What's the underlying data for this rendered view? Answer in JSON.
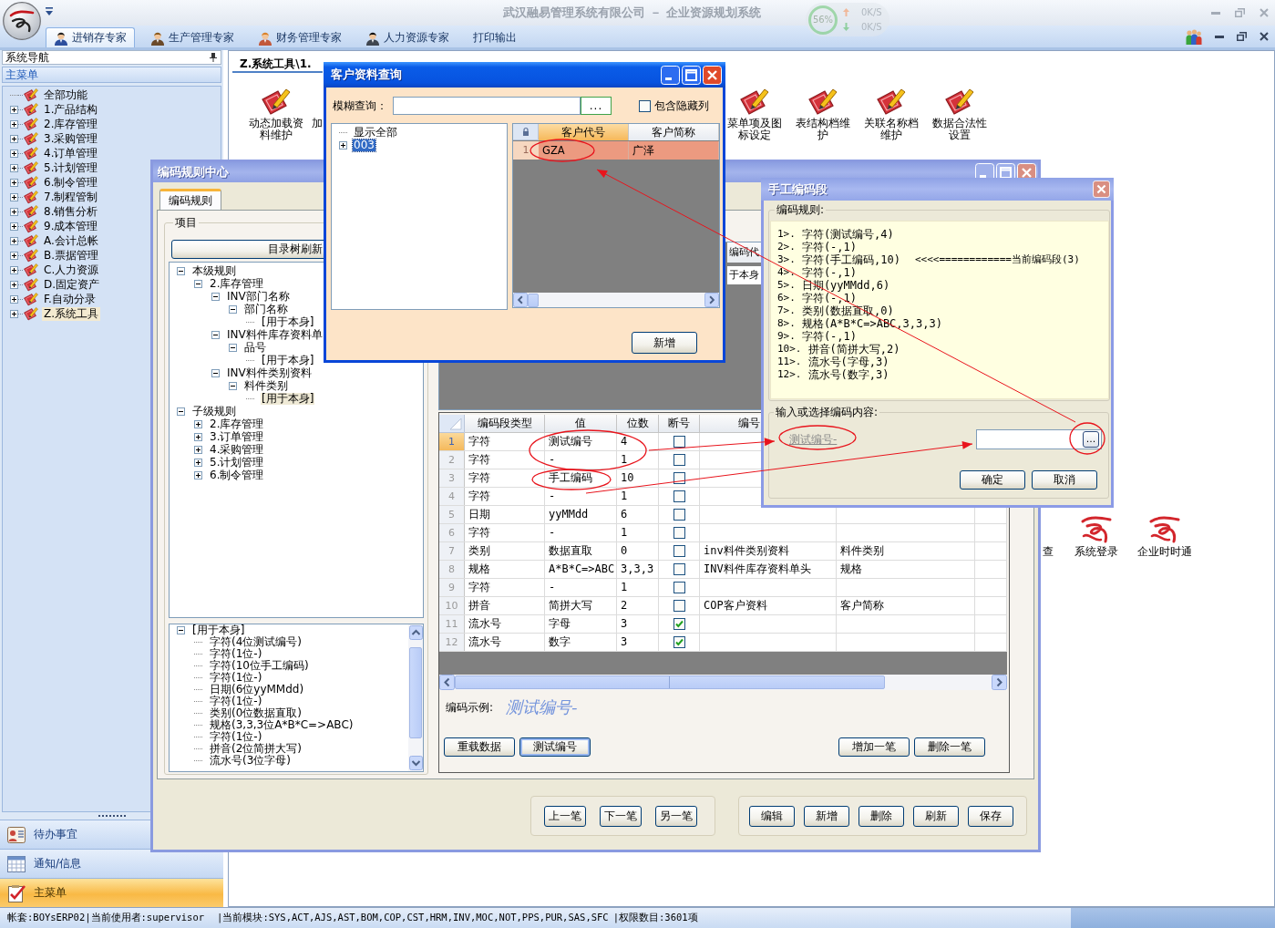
{
  "app": {
    "title": "武汉融易管理系统有限公司 － 企业资源规划系统"
  },
  "net_monitor": {
    "usage": "56%",
    "upload": "0K/S",
    "download": "0K/S"
  },
  "ribbon_tabs": [
    {
      "label": "进销存专家",
      "kind": "person",
      "selected": true
    },
    {
      "label": "生产管理专家",
      "kind": "person",
      "selected": false
    },
    {
      "label": "财务管理专家",
      "kind": "person",
      "selected": false
    },
    {
      "label": "人力资源专家",
      "kind": "person",
      "selected": false
    },
    {
      "label": "打印输出",
      "kind": "text",
      "selected": false
    }
  ],
  "sidebar": {
    "header": "系统导航",
    "menu_title": "主菜单",
    "tree": [
      {
        "label": "全部功能",
        "kind": "leaf",
        "selected": false
      },
      {
        "label": "1.产品结构",
        "kind": "folder",
        "expanded": false,
        "selected": false
      },
      {
        "label": "2.库存管理",
        "kind": "folder",
        "expanded": false,
        "selected": false
      },
      {
        "label": "3.采购管理",
        "kind": "folder",
        "expanded": false,
        "selected": false
      },
      {
        "label": "4.订单管理",
        "kind": "folder",
        "expanded": false,
        "selected": false
      },
      {
        "label": "5.计划管理",
        "kind": "folder",
        "expanded": false,
        "selected": false
      },
      {
        "label": "6.制令管理",
        "kind": "folder",
        "expanded": false,
        "selected": false
      },
      {
        "label": "7.制程管制",
        "kind": "folder",
        "expanded": false,
        "selected": false
      },
      {
        "label": "8.销售分析",
        "kind": "folder",
        "expanded": false,
        "selected": false
      },
      {
        "label": "9.成本管理",
        "kind": "folder",
        "expanded": false,
        "selected": false
      },
      {
        "label": "A.会计总帐",
        "kind": "folder",
        "expanded": false,
        "selected": false
      },
      {
        "label": "B.票据管理",
        "kind": "folder",
        "expanded": false,
        "selected": false
      },
      {
        "label": "C.人力资源",
        "kind": "folder",
        "expanded": false,
        "selected": false
      },
      {
        "label": "D.固定资产",
        "kind": "folder",
        "expanded": false,
        "selected": false
      },
      {
        "label": "F.自动分录",
        "kind": "folder",
        "expanded": false,
        "selected": false
      },
      {
        "label": "Z.系统工具",
        "kind": "folder",
        "expanded": false,
        "selected": true
      }
    ],
    "nav_buttons": [
      {
        "label": "待办事宜",
        "kind": "contacts",
        "selected": false
      },
      {
        "label": "通知/信息",
        "kind": "calendar",
        "selected": false
      },
      {
        "label": "主菜单",
        "kind": "checklist",
        "selected": true
      }
    ]
  },
  "document": {
    "tab": {
      "title": "Z.系统工具\\1.",
      "selected": true
    },
    "tool_groups": [
      [
        {
          "label": "动态加载资料维护",
          "kind": "tool"
        },
        {
          "label": "加",
          "kind": "fragment"
        }
      ],
      [
        {
          "label": "菜单项及图标设定",
          "kind": "tool"
        },
        {
          "label": "表结构档维护",
          "kind": "tool"
        },
        {
          "label": "关联名称档维护",
          "kind": "tool"
        },
        {
          "label": "数据合法性设置",
          "kind": "tool"
        }
      ],
      [
        {
          "label": "查",
          "kind": "fragment"
        },
        {
          "label": "系统登录",
          "kind": "logo"
        },
        {
          "label": "企业时时通",
          "kind": "logo"
        }
      ]
    ]
  },
  "coding_center": {
    "title": "编码规则中心",
    "tabs": [
      {
        "label": "编码规则",
        "selected": true
      }
    ],
    "group_title": "项目",
    "refresh_button": "目录树刷新",
    "rule_tree": [
      {
        "label": "本级规则",
        "kind": "folder",
        "expanded": true,
        "selected": false,
        "children": [
          {
            "label": "2.库存管理",
            "kind": "folder",
            "expanded": true,
            "selected": false,
            "children": [
              {
                "label": "INV部门名称",
                "kind": "folder",
                "expanded": true,
                "selected": false,
                "children": [
                  {
                    "label": "部门名称",
                    "kind": "folder",
                    "expanded": true,
                    "selected": false,
                    "children": [
                      {
                        "label": "[用于本身]",
                        "kind": "leaf",
                        "selected": false
                      }
                    ]
                  }
                ]
              },
              {
                "label": "INV料件库存资料单",
                "kind": "folder",
                "expanded": true,
                "selected": false,
                "children": [
                  {
                    "label": "品号",
                    "kind": "folder",
                    "expanded": true,
                    "selected": false,
                    "children": [
                      {
                        "label": "[用于本身]",
                        "kind": "leaf",
                        "selected": false
                      }
                    ]
                  }
                ]
              },
              {
                "label": "INV料件类别资料",
                "kind": "folder",
                "expanded": true,
                "selected": false,
                "children": [
                  {
                    "label": "料件类别",
                    "kind": "folder",
                    "expanded": true,
                    "selected": false,
                    "children": [
                      {
                        "label": "[用于本身]",
                        "kind": "leaf",
                        "selected": true
                      }
                    ]
                  }
                ]
              }
            ]
          }
        ]
      },
      {
        "label": "子级规则",
        "kind": "folder",
        "expanded": true,
        "selected": false,
        "children": [
          {
            "label": "2.库存管理",
            "kind": "folder",
            "expanded": false,
            "selected": false
          },
          {
            "label": "3.订单管理",
            "kind": "folder",
            "expanded": false,
            "selected": false
          },
          {
            "label": "4.采购管理",
            "kind": "folder",
            "expanded": false,
            "selected": false
          },
          {
            "label": "5.计划管理",
            "kind": "folder",
            "expanded": false,
            "selected": false
          },
          {
            "label": "6.制令管理",
            "kind": "folder",
            "expanded": false,
            "selected": false
          }
        ]
      }
    ],
    "segment_tree": [
      {
        "label": "[用于本身]",
        "kind": "folder",
        "expanded": true,
        "selected": false,
        "children": [
          {
            "label": "字符(4位测试编号)",
            "kind": "leaf",
            "selected": false
          },
          {
            "label": "字符(1位-)",
            "kind": "leaf",
            "selected": false
          },
          {
            "label": "字符(10位手工编码)",
            "kind": "leaf",
            "selected": false
          },
          {
            "label": "字符(1位-)",
            "kind": "leaf",
            "selected": false
          },
          {
            "label": "日期(6位yyMMdd)",
            "kind": "leaf",
            "selected": false
          },
          {
            "label": "字符(1位-)",
            "kind": "leaf",
            "selected": false
          },
          {
            "label": "类别(0位数据直取)",
            "kind": "leaf",
            "selected": false
          },
          {
            "label": "规格(3,3,3位A*B*C=>ABC)",
            "kind": "leaf",
            "selected": false
          },
          {
            "label": "字符(1位-)",
            "kind": "leaf",
            "selected": false
          },
          {
            "label": "拼音(2位简拼大写)",
            "kind": "leaf",
            "selected": false
          },
          {
            "label": "流水号(3位字母)",
            "kind": "leaf",
            "selected": false
          }
        ]
      }
    ],
    "upper_grid": {
      "column": "编码代",
      "cell": "于本身"
    },
    "grid": {
      "columns": [
        "编码段类型",
        "值",
        "位数",
        "断号",
        "编号"
      ],
      "rows": [
        {
          "no": "1",
          "segment_type": "字符",
          "value": "测试编号",
          "digits": "4",
          "break_number": false,
          "selected": true
        },
        {
          "no": "2",
          "segment_type": "字符",
          "value": "-",
          "digits": "1",
          "break_number": false,
          "selected": false
        },
        {
          "no": "3",
          "segment_type": "字符",
          "value": "手工编码",
          "digits": "10",
          "break_number": false,
          "selected": false
        },
        {
          "no": "4",
          "segment_type": "字符",
          "value": "-",
          "digits": "1",
          "break_number": false,
          "selected": false
        },
        {
          "no": "5",
          "segment_type": "日期",
          "value": "yyMMdd",
          "digits": "6",
          "break_number": false,
          "selected": false
        },
        {
          "no": "6",
          "segment_type": "字符",
          "value": "-",
          "digits": "1",
          "break_number": false,
          "selected": false
        },
        {
          "no": "7",
          "segment_type": "类别",
          "value": "数据直取",
          "digits": "0",
          "break_number": false,
          "column_5": "inv料件类别资料",
          "column_6": "料件类别",
          "selected": false
        },
        {
          "no": "8",
          "segment_type": "规格",
          "value": "A*B*C=>ABC",
          "digits": "3,3,3",
          "break_number": false,
          "column_5": "INV料件库存资料单头",
          "column_6": "规格",
          "selected": false
        },
        {
          "no": "9",
          "segment_type": "字符",
          "value": "-",
          "digits": "1",
          "break_number": false,
          "selected": false
        },
        {
          "no": "10",
          "segment_type": "拼音",
          "value": "简拼大写",
          "digits": "2",
          "break_number": false,
          "column_5": "COP客户资料",
          "column_6": "客户简称",
          "selected": false
        },
        {
          "no": "11",
          "segment_type": "流水号",
          "value": "字母",
          "digits": "3",
          "break_number": true,
          "selected": false
        },
        {
          "no": "12",
          "segment_type": "流水号",
          "value": "数字",
          "digits": "3",
          "break_number": true,
          "selected": false
        }
      ]
    },
    "example_label": "编码示例:",
    "example": "测试编号-",
    "edit_buttons": [
      {
        "label": "重载数据",
        "focused": false
      },
      {
        "label": "测试编号",
        "focused": true
      }
    ],
    "row_buttons": [
      "增加一笔",
      "删除一笔"
    ],
    "nav_buttons": [
      "上一笔",
      "下一笔",
      "另一笔"
    ],
    "action_buttons": [
      "编辑",
      "新增",
      "删除",
      "刷新",
      "保存"
    ]
  },
  "customer_dialog": {
    "title": "客户资料查询",
    "search_label": "模糊查询：",
    "browse_button": "...",
    "show_hidden": {
      "label": "包含隐藏列",
      "checked": false
    },
    "tree": [
      {
        "label": "显示全部",
        "kind": "leaf",
        "selected": false
      },
      {
        "label": "003",
        "kind": "folder",
        "expanded": false,
        "selected": true
      }
    ],
    "grid": {
      "columns": [
        {
          "label": "客户代号",
          "selected": true
        },
        {
          "label": "客户简称",
          "selected": false
        }
      ],
      "rows": [
        {
          "no": "1",
          "code": "GZA",
          "name": "广泽",
          "selected": true
        }
      ]
    },
    "add_button": "新增"
  },
  "manual_dialog": {
    "title": "手工编码段",
    "rules_label": "编码规则:",
    "rules": [
      {
        "no": "1>.",
        "text": "字符(测试编号,4)"
      },
      {
        "no": "2>.",
        "text": "字符(-,1)"
      },
      {
        "no": "3>.",
        "text": "字符(手工编码,10)",
        "note": "<<<<============当前编码段(3)"
      },
      {
        "no": "4>.",
        "text": "字符(-,1)"
      },
      {
        "no": "5>.",
        "text": "日期(yyMMdd,6)"
      },
      {
        "no": "6>.",
        "text": "字符(-,1)"
      },
      {
        "no": "7>.",
        "text": "类别(数据直取,0)"
      },
      {
        "no": "8>.",
        "text": "规格(A*B*C=>ABC,3,3,3)"
      },
      {
        "no": "9>.",
        "text": "字符(-,1)"
      },
      {
        "no": "10>.",
        "text": "拼音(简拼大写,2)"
      },
      {
        "no": "11>.",
        "text": "流水号(字母,3)"
      },
      {
        "no": "12>.",
        "text": "流水号(数字,3)"
      }
    ],
    "input_label": "输入或选择编码内容:",
    "prefix": "测试编号-",
    "browse_button": "...",
    "buttons": [
      "确定",
      "取消"
    ]
  },
  "status_bar": {
    "account": "帐套:BOYsERP02|当前使用者:supervisor",
    "modules": "|当前模块:SYS,ACT,AJS,AST,BOM,COP,CST,HRM,INV,MOC,NOT,PPS,PUR,SAS,SFC",
    "permissions": "|权限数目:3601项"
  }
}
